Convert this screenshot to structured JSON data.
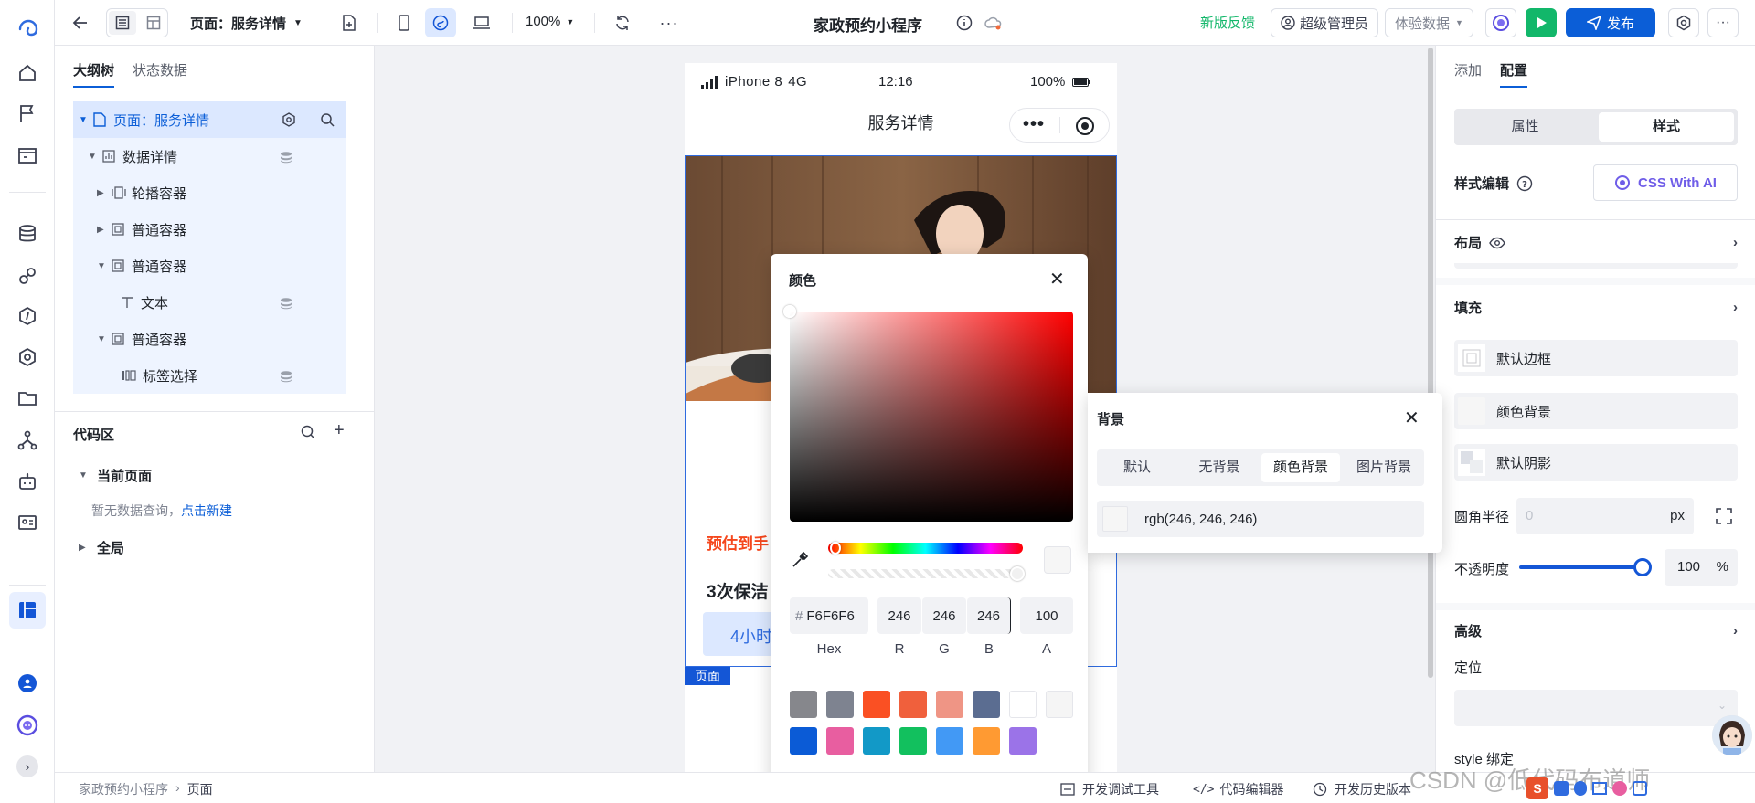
{
  "app": {
    "title": "家政预约小程序",
    "page_selector": "页面：服务详情",
    "zoom": "100%"
  },
  "topbar": {
    "feedback": "新版反馈",
    "admin": "超级管理员",
    "data_mode": "体验数据",
    "publish": "发布"
  },
  "left": {
    "tabs": [
      "大纲树",
      "状态数据"
    ],
    "tree": [
      {
        "label": "页面：服务详情",
        "icon": "page-icon"
      },
      {
        "label": "数据详情",
        "icon": "data-detail-icon"
      },
      {
        "label": "轮播容器",
        "icon": "carousel-icon"
      },
      {
        "label": "普通容器",
        "icon": "container-icon"
      },
      {
        "label": "普通容器",
        "icon": "container-icon"
      },
      {
        "label": "文本",
        "icon": "text-icon"
      },
      {
        "label": "普通容器",
        "icon": "container-icon"
      },
      {
        "label": "标签选择",
        "icon": "tag-select-icon"
      }
    ],
    "code": {
      "title": "代码区",
      "current_page": "当前页面",
      "empty": "暂无数据查询，",
      "create_link": "点击新建",
      "global": "全局"
    }
  },
  "phone": {
    "status": {
      "carrier": "iPhone 8",
      "network": "4G",
      "time": "12:16",
      "battery": "100%"
    },
    "nav_title": "服务详情",
    "price_text": "预估到手",
    "service_text": "3次保洁",
    "chip_text": "4小时",
    "page_badge": "页面"
  },
  "color_picker": {
    "title": "颜色",
    "hex": "F6F6F6",
    "hex_prefix": "#",
    "r": "246",
    "g": "246",
    "b": "246",
    "a": "100",
    "labels": {
      "hex": "Hex",
      "r": "R",
      "g": "G",
      "b": "B",
      "a": "A"
    },
    "swatches": [
      "#86878c",
      "#7e8390",
      "#fa5023",
      "#f0603c",
      "#ef9585",
      "#5b6d91",
      "#ffffff",
      "#f5f5f5",
      "#0b5bd6",
      "#e85ea0",
      "#1299c7",
      "#12c05e",
      "#4299f5",
      "#ff9a32",
      "#9b73e8"
    ]
  },
  "bg_popup": {
    "title": "背景",
    "tabs": [
      "默认",
      "无背景",
      "颜色背景",
      "图片背景"
    ],
    "active_tab": 2,
    "value": "rgb(246, 246, 246)"
  },
  "right": {
    "tabs": [
      "添加",
      "配置"
    ],
    "segment": [
      "属性",
      "样式"
    ],
    "style_edit": "样式编辑",
    "css_ai": "CSS With AI",
    "layout": "布局",
    "fill": "填充",
    "fill_items": [
      "默认边框",
      "颜色背景",
      "默认阴影"
    ],
    "radius_label": "圆角半径",
    "radius_placeholder": "0",
    "radius_unit": "px",
    "opacity_label": "不透明度",
    "opacity_value": "100",
    "opacity_unit": "%",
    "advanced": "高级",
    "position": "定位",
    "style_bind": "style 绑定"
  },
  "footer": {
    "breadcrumb": [
      "家政预约小程序",
      "页面"
    ],
    "devtools": "开发调试工具",
    "code_editor": "代码编辑器",
    "history": "开发历史版本"
  },
  "watermark": "CSDN @低代码布道师"
}
